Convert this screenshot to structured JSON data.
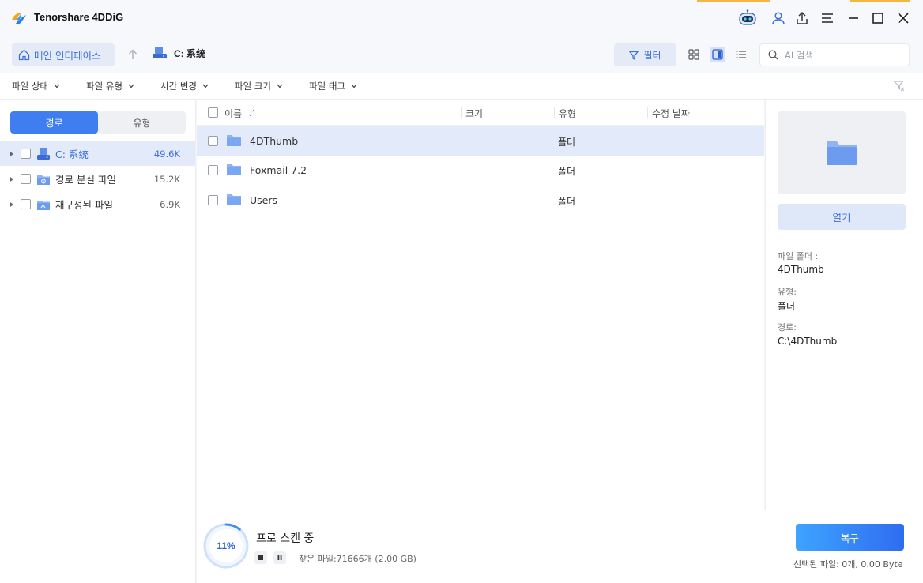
{
  "app": {
    "title": "Tenorshare 4DDiG"
  },
  "nav": {
    "home_label": "메인 인터페이스",
    "drive_label": "C: 系统",
    "filter_label": "필터",
    "search_placeholder": "AI 검색"
  },
  "filters": [
    "파일 상태",
    "파일 유형",
    "시간 변경",
    "파일 크기",
    "파일 태그"
  ],
  "left": {
    "tabs": [
      "경로",
      "유형"
    ],
    "active_tab": "경로",
    "tree": [
      {
        "label": "C: 系统",
        "count": "49.6K",
        "icon": "drive-icon",
        "selected": true
      },
      {
        "label": "경로 분실 파일",
        "count": "15.2K",
        "icon": "lost-folder-icon",
        "selected": false
      },
      {
        "label": "재구성된 파일",
        "count": "6.9K",
        "icon": "rebuilt-folder-icon",
        "selected": false
      }
    ]
  },
  "list": {
    "columns": {
      "name": "이름",
      "size": "크기",
      "type": "유형",
      "modified": "수정 날짜"
    },
    "rows": [
      {
        "name": "4DThumb",
        "type": "폴더",
        "selected": true
      },
      {
        "name": "Foxmail 7.2",
        "type": "폴더",
        "selected": false
      },
      {
        "name": "Users",
        "type": "폴더",
        "selected": false
      }
    ]
  },
  "details": {
    "open_label": "열기",
    "folder_label": "파일 폴더 :",
    "folder_value": "4DThumb",
    "type_label": "유형:",
    "type_value": "폴더",
    "path_label": "경로:",
    "path_value": "C:\\4DThumb"
  },
  "scan": {
    "percent_text": "11%",
    "progress": 0.11,
    "title": "프로 스캔 중",
    "found_text": "찾은 파일:71666개 (2.00 GB)"
  },
  "recover": {
    "button_label": "복구",
    "selected_text": "선택된 파일: 0개, 0.00 Byte"
  },
  "colors": {
    "accent": "#3f7ef0",
    "selected_row": "#e3ebfa",
    "folder": "#7aa6f2"
  }
}
